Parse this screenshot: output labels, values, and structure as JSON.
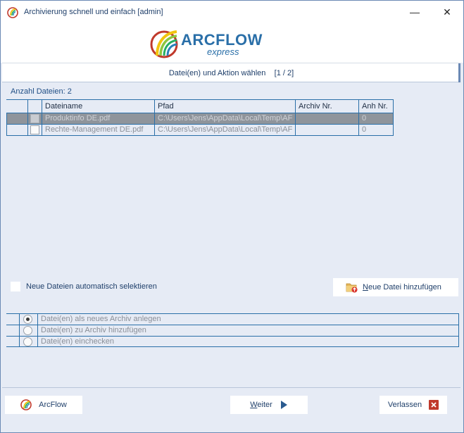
{
  "window": {
    "title": "Archivierung schnell und einfach  [admin]",
    "minimize_glyph": "—",
    "close_glyph": "✕"
  },
  "logo": {
    "main": "ARCFLOW",
    "sub": "express"
  },
  "step": {
    "label": "Datei(en) und Aktion wählen    [1 / 2]"
  },
  "files": {
    "count_label": "Anzahl Dateien: 2",
    "columns": [
      "Dateiname",
      "Pfad",
      "Archiv Nr.",
      "Anh Nr."
    ],
    "rows": [
      {
        "name": "Produktinfo DE.pdf",
        "path": "C:\\Users\\Jens\\AppData\\Local\\Temp\\AF",
        "archive": "",
        "attach": "0",
        "selected": true
      },
      {
        "name": "Rechte-Management DE.pdf",
        "path": "C:\\Users\\Jens\\AppData\\Local\\Temp\\AF",
        "archive": "",
        "attach": "0",
        "selected": false
      }
    ]
  },
  "auto_select": {
    "label": "Neue Dateien automatisch selektieren"
  },
  "add_file": {
    "label_underlined": "N",
    "label_rest": "eue Datei hinzufügen",
    "icon": "folder-add-icon"
  },
  "actions": [
    {
      "label": "Datei(en) als neues Archiv anlegen",
      "selected": true
    },
    {
      "label": "Datei(en) zu Archiv hinzufügen",
      "selected": false
    },
    {
      "label": "Datei(en) einchecken",
      "selected": false
    }
  ],
  "buttons": {
    "arcflow": "ArcFlow",
    "weiter_underlined": "W",
    "weiter_rest": "eiter",
    "verlassen": "Verlassen"
  },
  "colors": {
    "accent": "#2a6fa8",
    "background": "#e6ebf5",
    "selected_row": "#8f949b",
    "close_red": "#c0392b"
  }
}
